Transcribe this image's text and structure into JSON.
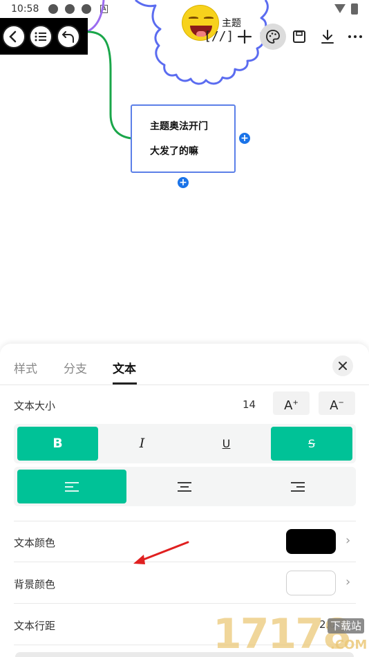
{
  "status_bar": {
    "time": "10:58"
  },
  "canvas": {
    "topic_label": "主题",
    "node_lines": [
      "主题奥法开门",
      "大发了的嘛"
    ],
    "add_symbol": "+"
  },
  "toolbar": {
    "bracket_label": "[//]"
  },
  "sheet": {
    "tabs": [
      "样式",
      "分支",
      "文本"
    ],
    "active_tab": 2,
    "text_size": {
      "label": "文本大小",
      "value": "14",
      "increase": "A",
      "decrease": "A",
      "increase_sup": "+",
      "decrease_sup": "−"
    },
    "format_buttons": [
      {
        "name": "bold",
        "label": "B",
        "active": true
      },
      {
        "name": "italic",
        "label": "I",
        "active": false
      },
      {
        "name": "underline",
        "label": "U",
        "active": false
      },
      {
        "name": "strikethrough",
        "label": "S",
        "active": true
      }
    ],
    "align_buttons": [
      {
        "name": "align-left",
        "active": true
      },
      {
        "name": "align-center",
        "active": false
      },
      {
        "name": "align-right",
        "active": false
      }
    ],
    "text_color": {
      "label": "文本颜色",
      "value": "#000000"
    },
    "bg_color": {
      "label": "背景颜色",
      "value": "#ffffff"
    },
    "line_spacing": {
      "label": "文本行距",
      "value": "2.0"
    }
  },
  "colors": {
    "accent": "#00c297",
    "node_border": "#5b7fe8",
    "branch_green": "#1aa64a",
    "cloud_blue": "#5b6cf0",
    "annotation_red": "#e02020"
  },
  "watermark": {
    "digits": "17178",
    "badge": "下载站",
    "domain": ".COM"
  }
}
